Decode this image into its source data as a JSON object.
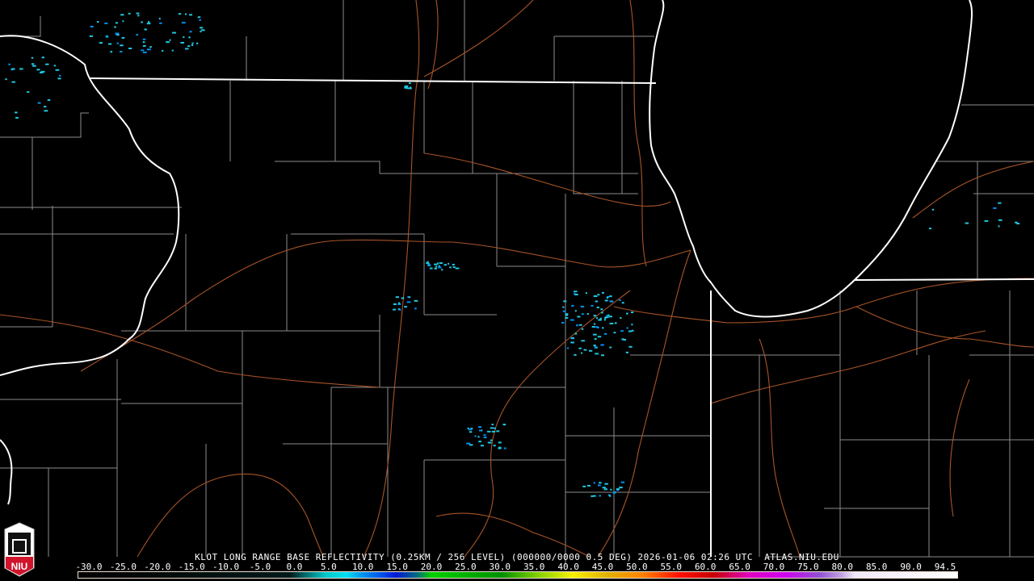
{
  "title": "KLOT LONG RANGE BASE REFLECTIVITY (0.25KM / 256 LEVEL) (000000/0000 0.5 DEG) 2026-01-06 02:26 UTC  ATLAS.NIU.EDU",
  "logo_text": "NIU",
  "colorbar": {
    "min": -30.0,
    "max": 94.5,
    "labels": [
      "-30.0",
      "-25.0",
      "-20.0",
      "-15.0",
      "-10.0",
      "-5.0",
      "0.0",
      "5.0",
      "10.0",
      "15.0",
      "20.0",
      "25.0",
      "30.0",
      "35.0",
      "40.0",
      "45.0",
      "50.0",
      "55.0",
      "60.0",
      "65.0",
      "70.0",
      "75.0",
      "80.0",
      "85.0",
      "90.0",
      "94.5"
    ],
    "stops": [
      {
        "v": -30,
        "c": "#000000"
      },
      {
        "v": 0,
        "c": "#001a1a"
      },
      {
        "v": 2,
        "c": "#006666"
      },
      {
        "v": 5,
        "c": "#00c8c8"
      },
      {
        "v": 8,
        "c": "#00e0f0"
      },
      {
        "v": 10,
        "c": "#0098f0"
      },
      {
        "v": 13,
        "c": "#0050e8"
      },
      {
        "v": 15,
        "c": "#0018d8"
      },
      {
        "v": 18,
        "c": "#006a80"
      },
      {
        "v": 20,
        "c": "#00d000"
      },
      {
        "v": 25,
        "c": "#00b000"
      },
      {
        "v": 30,
        "c": "#009000"
      },
      {
        "v": 35,
        "c": "#80d000"
      },
      {
        "v": 40,
        "c": "#f8f000"
      },
      {
        "v": 45,
        "c": "#e0b000"
      },
      {
        "v": 50,
        "c": "#ff8000"
      },
      {
        "v": 55,
        "c": "#ff1000"
      },
      {
        "v": 60,
        "c": "#c80000"
      },
      {
        "v": 65,
        "c": "#e000c0"
      },
      {
        "v": 70,
        "c": "#d000f0"
      },
      {
        "v": 75,
        "c": "#9050d0"
      },
      {
        "v": 78,
        "c": "#c0a0e0"
      },
      {
        "v": 80,
        "c": "#f0e8f8"
      },
      {
        "v": 94.5,
        "c": "#ffffff"
      }
    ]
  },
  "colors": {
    "state": "#ffffff",
    "county": "#9a9a9a",
    "road": "#b05a2a",
    "echo": "#20c8e0"
  }
}
